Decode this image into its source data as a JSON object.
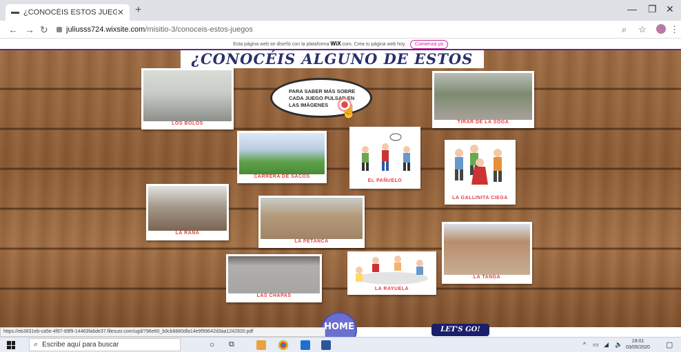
{
  "browser": {
    "tab_title": "¿CONOCÉIS ESTOS JUEGOS? | M",
    "tab_close": "✕",
    "new_tab": "+",
    "url_host": "juliusss724.wixsite.com",
    "url_path": "/misitio-3/conoceis-estos-juegos",
    "win_minimize": "—",
    "win_restore": "❐",
    "win_close": "✕"
  },
  "wix_banner": {
    "text_before": "Esta página web se diseñó con la plataforma",
    "brand": "WiX",
    "text_after": ".com. Crea tu página web hoy.",
    "cta": "Comienza ya"
  },
  "page": {
    "title": "¿CONOCÉIS ALGUNO DE ESTOS JUEGOS?",
    "bubble_lines": [
      "PARA SABER MÁS SOBRE",
      "CADA JUEGO PULSAD EN",
      "LAS IMÁGENES"
    ],
    "home": "HOME",
    "lets_go": "LET'S GO!"
  },
  "games": [
    {
      "label": "LOS BOLOS"
    },
    {
      "label": "TIRAR DE LA SOGA"
    },
    {
      "label": "CARRERA DE SACOS"
    },
    {
      "label": "EL PAÑUELO"
    },
    {
      "label": "LA GALLINITA CIEGA"
    },
    {
      "label": "LA RANA"
    },
    {
      "label": "LA PETANCA"
    },
    {
      "label": "LA TANGA"
    },
    {
      "label": "LAS CHAPAS"
    },
    {
      "label": "LA RAYUELA"
    }
  ],
  "status_url": "https://eb3831eb-ca5e-4f87-89f9-14463fa6de37.filesusr.com/ugd/796e60_b9cb8880dfa14e9f99642d3aa1242920.pdf",
  "taskbar": {
    "search_placeholder": "Escribe aquí para buscar",
    "time": "19:01",
    "date": "03/05/2020"
  },
  "colors": {
    "caption": "#e53d3d",
    "title": "#2a2f6b",
    "home": "#6a6fd0",
    "lets_go": "#1a1f6b",
    "wix_accent": "#d020a0"
  }
}
